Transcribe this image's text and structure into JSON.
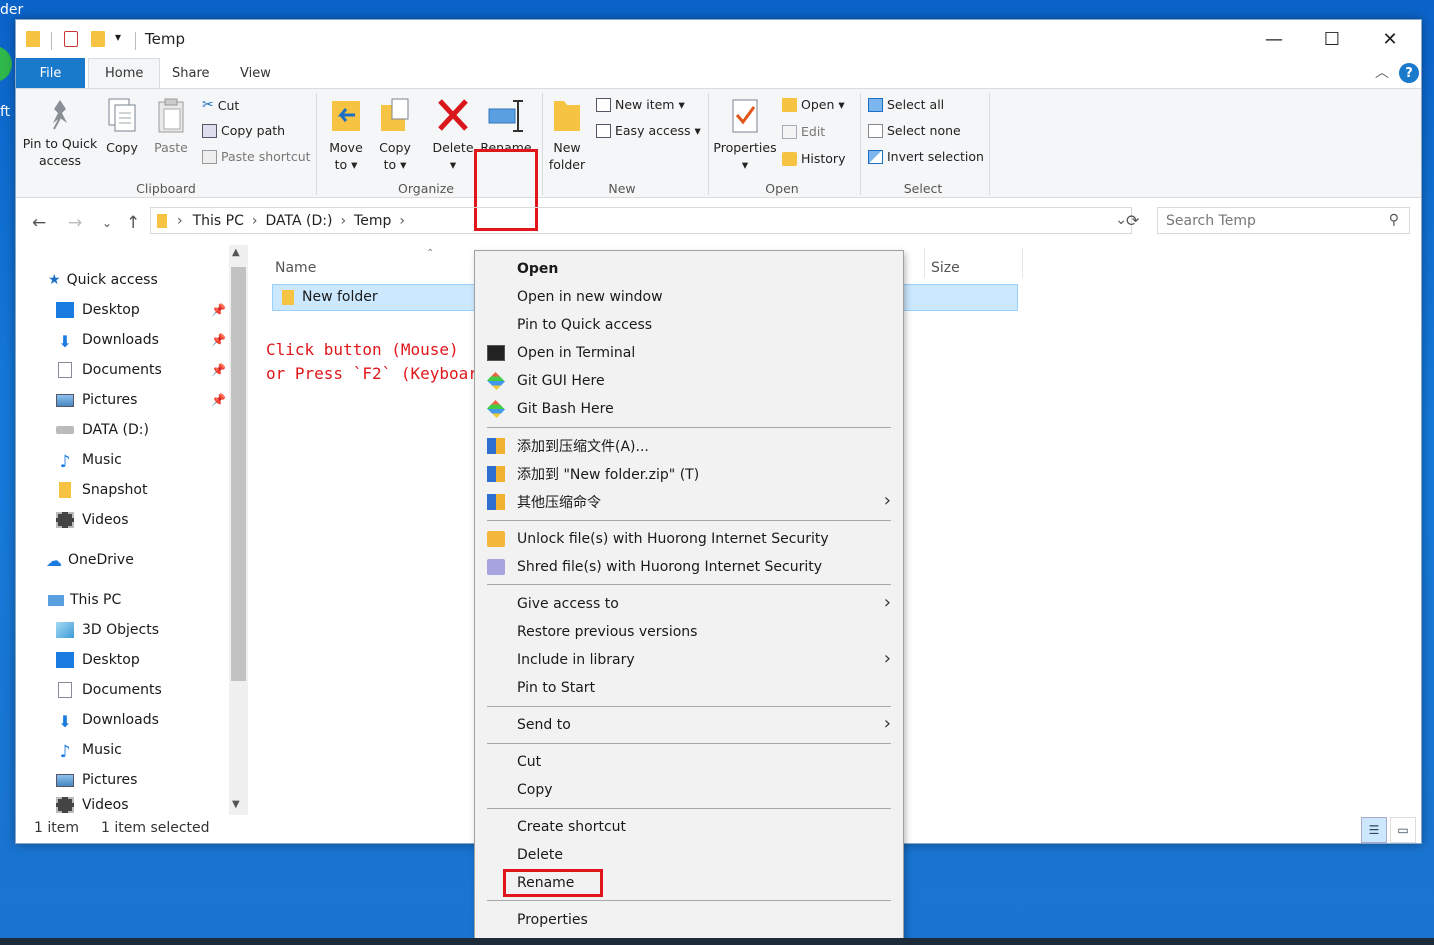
{
  "desktop": {
    "text_top": "der",
    "text_side": "ft"
  },
  "window": {
    "title": "Temp",
    "quick_access_toolbar": {
      "dropdown": "▾"
    },
    "controls": {
      "minimize": "—",
      "maximize": "☐",
      "close": "✕"
    }
  },
  "ribbon_tabs": {
    "file": "File",
    "home": "Home",
    "share": "Share",
    "view": "View",
    "help": "?"
  },
  "clipboard": {
    "pin_line1": "Pin to Quick",
    "pin_line2": "access",
    "copy": "Copy",
    "paste": "Paste",
    "cut": "Cut",
    "copy_path": "Copy path",
    "paste_shortcut": "Paste shortcut",
    "label": "Clipboard"
  },
  "organize": {
    "move_line1": "Move",
    "move_line2": "to ▾",
    "copy_line1": "Copy",
    "copy_line2": "to ▾",
    "delete_line1": "Delete",
    "delete_line2": "▾",
    "rename": "Rename",
    "label": "Organize"
  },
  "new_group": {
    "new_folder_line1": "New",
    "new_folder_line2": "folder",
    "new_item": "New item ▾",
    "easy_access": "Easy access ▾",
    "label": "New"
  },
  "open_group": {
    "properties_line1": "Properties",
    "properties_line2": "▾",
    "open": "Open ▾",
    "edit": "Edit",
    "history": "History",
    "label": "Open"
  },
  "select_group": {
    "select_all": "Select all",
    "select_none": "Select none",
    "invert_selection": "Invert selection",
    "label": "Select"
  },
  "address": {
    "crumbs": [
      "This PC",
      "DATA (D:)",
      "Temp"
    ],
    "search_placeholder": "Search Temp"
  },
  "nav_pane": {
    "quick_access": "Quick access",
    "items": [
      "Desktop",
      "Downloads",
      "Documents",
      "Pictures",
      "DATA (D:)",
      "Music",
      "Snapshot",
      "Videos"
    ],
    "onedrive": "OneDrive",
    "this_pc": "This PC",
    "pc_items": [
      "3D Objects",
      "Desktop",
      "Documents",
      "Downloads",
      "Music",
      "Pictures",
      "Videos"
    ]
  },
  "file_list": {
    "col_name": "Name",
    "col_size": "Size",
    "rows": [
      {
        "name": "New folder"
      }
    ]
  },
  "annotation": {
    "line1": "Click button (Mouse)",
    "line2": "or Press `F2` (Keyboard)"
  },
  "status": {
    "item_count": "1 item",
    "selected": "1 item selected"
  },
  "context_menu": {
    "open": "Open",
    "open_new_window": "Open in new window",
    "pin_quick": "Pin to Quick access",
    "open_terminal": "Open in Terminal",
    "git_gui": "Git GUI Here",
    "git_bash": "Git Bash Here",
    "add_archive": "添加到压缩文件(A)...",
    "add_zip": "添加到 \"New folder.zip\" (T)",
    "other_compress": "其他压缩命令",
    "unlock": "Unlock file(s) with Huorong Internet Security",
    "shred": "Shred file(s) with Huorong Internet Security",
    "give_access": "Give access to",
    "restore": "Restore previous versions",
    "include_library": "Include in library",
    "pin_start": "Pin to Start",
    "send_to": "Send to",
    "cut": "Cut",
    "copy": "Copy",
    "create_shortcut": "Create shortcut",
    "delete": "Delete",
    "rename": "Rename",
    "properties": "Properties"
  },
  "colors": {
    "accent": "#1979ca",
    "highlight": "#e0161b",
    "selection": "#cce8ff"
  }
}
